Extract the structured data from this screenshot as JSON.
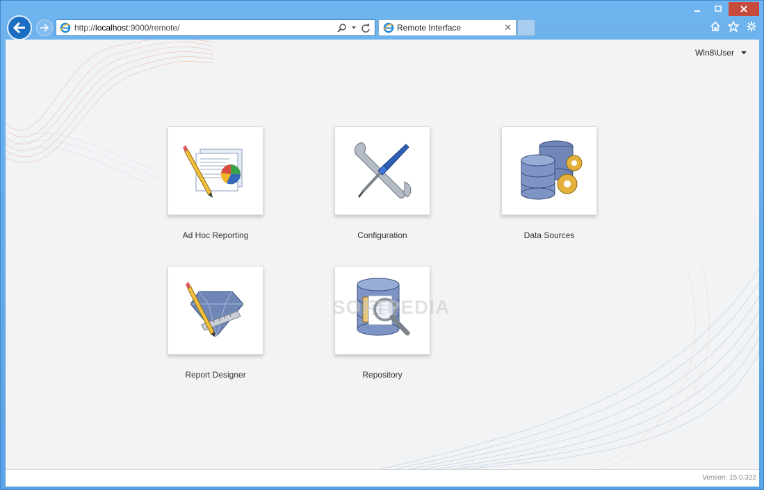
{
  "browser": {
    "url_prefix": "http://",
    "url_host": "localhost",
    "url_rest": ":9000/remote/",
    "tab_title": "Remote Interface"
  },
  "user": {
    "name": "Win8\\User"
  },
  "tiles": [
    {
      "label": "Ad Hoc Reporting"
    },
    {
      "label": "Configuration"
    },
    {
      "label": "Data Sources"
    },
    {
      "label": "Report Designer"
    },
    {
      "label": "Repository"
    }
  ],
  "watermark": "SOFTPEDIA",
  "status": {
    "version": "Version: 15.0.322"
  },
  "colors": {
    "accent": "#1b6ec2",
    "frame": "#5fa8e8"
  }
}
